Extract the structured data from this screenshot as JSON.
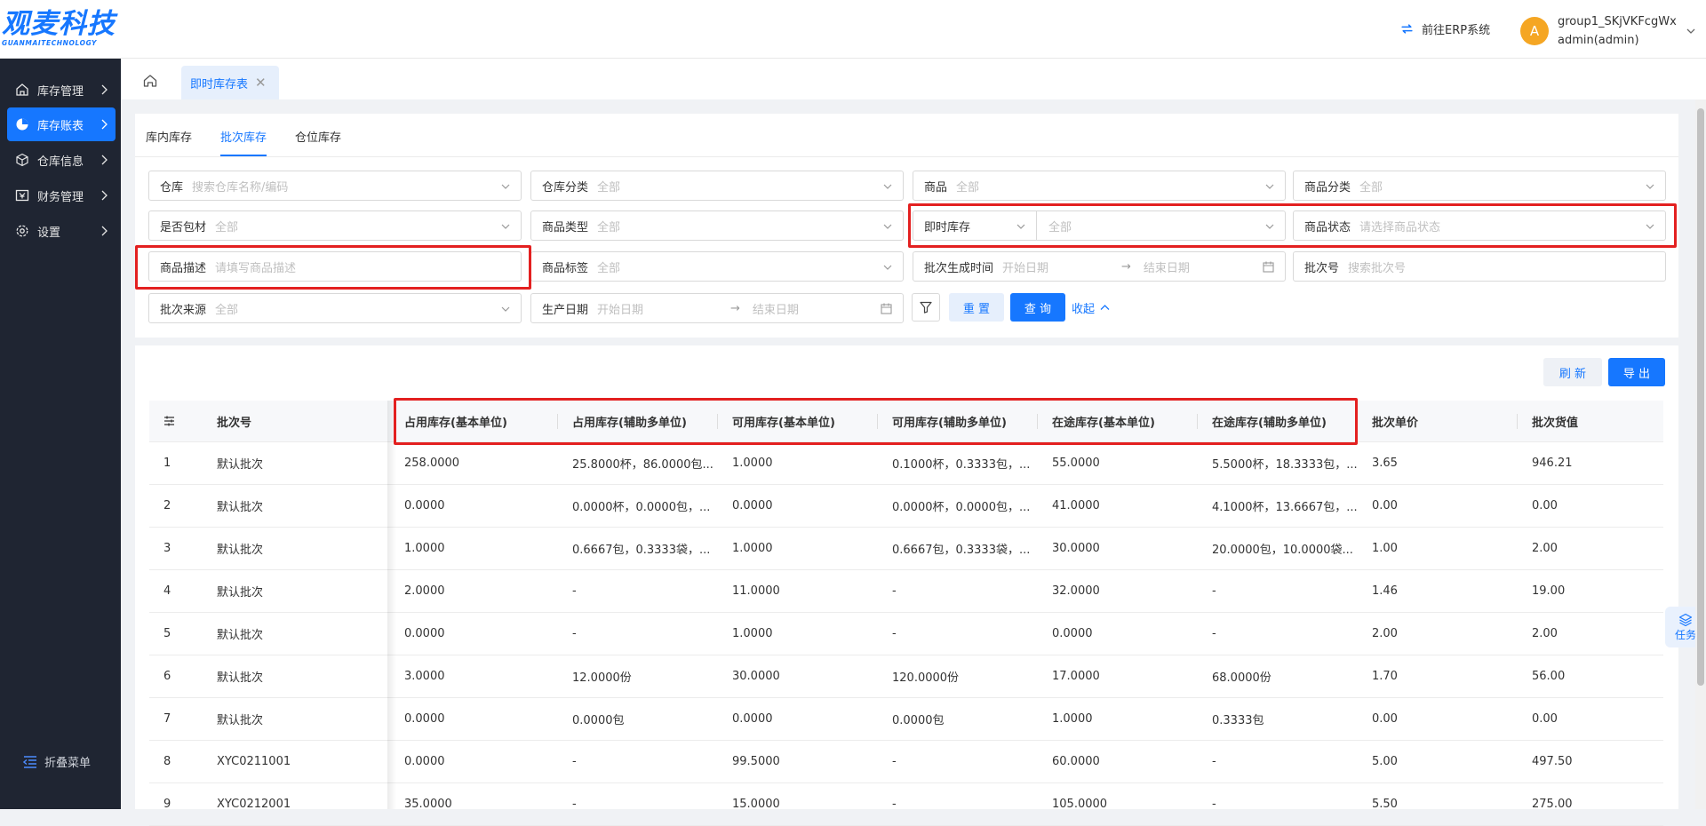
{
  "header": {
    "logo_cn": "观麦科技",
    "logo_en": "GUANMAITECHNOLOGY",
    "erp_link": "前往ERP系统",
    "avatar_letter": "A",
    "user_group": "group1_SKjVKFcgWx",
    "user_name": "admin(admin)"
  },
  "sidebar": {
    "items": [
      {
        "label": "库存管理",
        "icon": "home-icon"
      },
      {
        "label": "库存账表",
        "icon": "pie-chart-icon"
      },
      {
        "label": "仓库信息",
        "icon": "cube-icon"
      },
      {
        "label": "财务管理",
        "icon": "finance-icon"
      },
      {
        "label": "设置",
        "icon": "gear-icon"
      }
    ],
    "active_index": 1,
    "collapse_label": "折叠菜单"
  },
  "tabs": {
    "page_tab": "即时库存表"
  },
  "subtabs": [
    "库内库存",
    "批次库存",
    "仓位库存"
  ],
  "filters": {
    "warehouse": {
      "label": "仓库",
      "placeholder": "搜索仓库名称/编码"
    },
    "warehouse_category": {
      "label": "仓库分类",
      "value": "全部"
    },
    "product": {
      "label": "商品",
      "value": "全部"
    },
    "product_category": {
      "label": "商品分类",
      "value": "全部"
    },
    "is_packaging": {
      "label": "是否包材",
      "value": "全部"
    },
    "product_type": {
      "label": "商品类型",
      "value": "全部"
    },
    "instant_stock": {
      "label": "即时库存",
      "value": "全部"
    },
    "product_status": {
      "label": "商品状态",
      "placeholder": "请选择商品状态"
    },
    "product_desc": {
      "label": "商品描述",
      "placeholder": "请填写商品描述"
    },
    "product_tag": {
      "label": "商品标签",
      "value": "全部"
    },
    "batch_time": {
      "label": "批次生成时间",
      "start": "开始日期",
      "end": "结束日期"
    },
    "batch_no": {
      "label": "批次号",
      "placeholder": "搜索批次号"
    },
    "batch_source": {
      "label": "批次来源",
      "value": "全部"
    },
    "production_date": {
      "label": "生产日期",
      "start": "开始日期",
      "end": "结束日期"
    }
  },
  "buttons": {
    "reset": "重 置",
    "query": "查 询",
    "collapse": "收起",
    "refresh": "刷 新",
    "export": "导 出"
  },
  "table": {
    "columns": [
      "批次号",
      "占用库存(基本单位)",
      "占用库存(辅助多单位)",
      "可用库存(基本单位)",
      "可用库存(辅助多单位)",
      "在途库存(基本单位)",
      "在途库存(辅助多单位)",
      "批次单价",
      "批次货值"
    ],
    "rows": [
      [
        "1",
        "默认批次",
        "258.0000",
        "25.8000杯，86.0000包...",
        "1.0000",
        "0.1000杯，0.3333包，...",
        "55.0000",
        "5.5000杯，18.3333包，...",
        "3.65",
        "946.21"
      ],
      [
        "2",
        "默认批次",
        "0.0000",
        "0.0000杯，0.0000包，...",
        "0.0000",
        "0.0000杯，0.0000包，...",
        "41.0000",
        "4.1000杯，13.6667包，...",
        "0.00",
        "0.00"
      ],
      [
        "3",
        "默认批次",
        "1.0000",
        "0.6667包，0.3333袋，...",
        "1.0000",
        "0.6667包，0.3333袋，...",
        "30.0000",
        "20.0000包，10.0000袋...",
        "1.00",
        "2.00"
      ],
      [
        "4",
        "默认批次",
        "2.0000",
        "-",
        "11.0000",
        "-",
        "32.0000",
        "-",
        "1.46",
        "19.00"
      ],
      [
        "5",
        "默认批次",
        "0.0000",
        "-",
        "1.0000",
        "-",
        "0.0000",
        "-",
        "2.00",
        "2.00"
      ],
      [
        "6",
        "默认批次",
        "3.0000",
        "12.0000份",
        "30.0000",
        "120.0000份",
        "17.0000",
        "68.0000份",
        "1.70",
        "56.00"
      ],
      [
        "7",
        "默认批次",
        "0.0000",
        "0.0000包",
        "0.0000",
        "0.0000包",
        "1.0000",
        "0.3333包",
        "0.00",
        "0.00"
      ],
      [
        "8",
        "XYC0211001",
        "0.0000",
        "-",
        "99.5000",
        "-",
        "60.0000",
        "-",
        "5.00",
        "497.50"
      ],
      [
        "9",
        "XYC0212001",
        "35.0000",
        "-",
        "15.0000",
        "-",
        "105.0000",
        "-",
        "5.50",
        "275.00"
      ]
    ]
  },
  "task_float": "任务",
  "colors": {
    "primary": "#1677ff",
    "sidebar_bg": "#1f2532",
    "highlight_red": "#e32020",
    "avatar": "#f5a623"
  }
}
